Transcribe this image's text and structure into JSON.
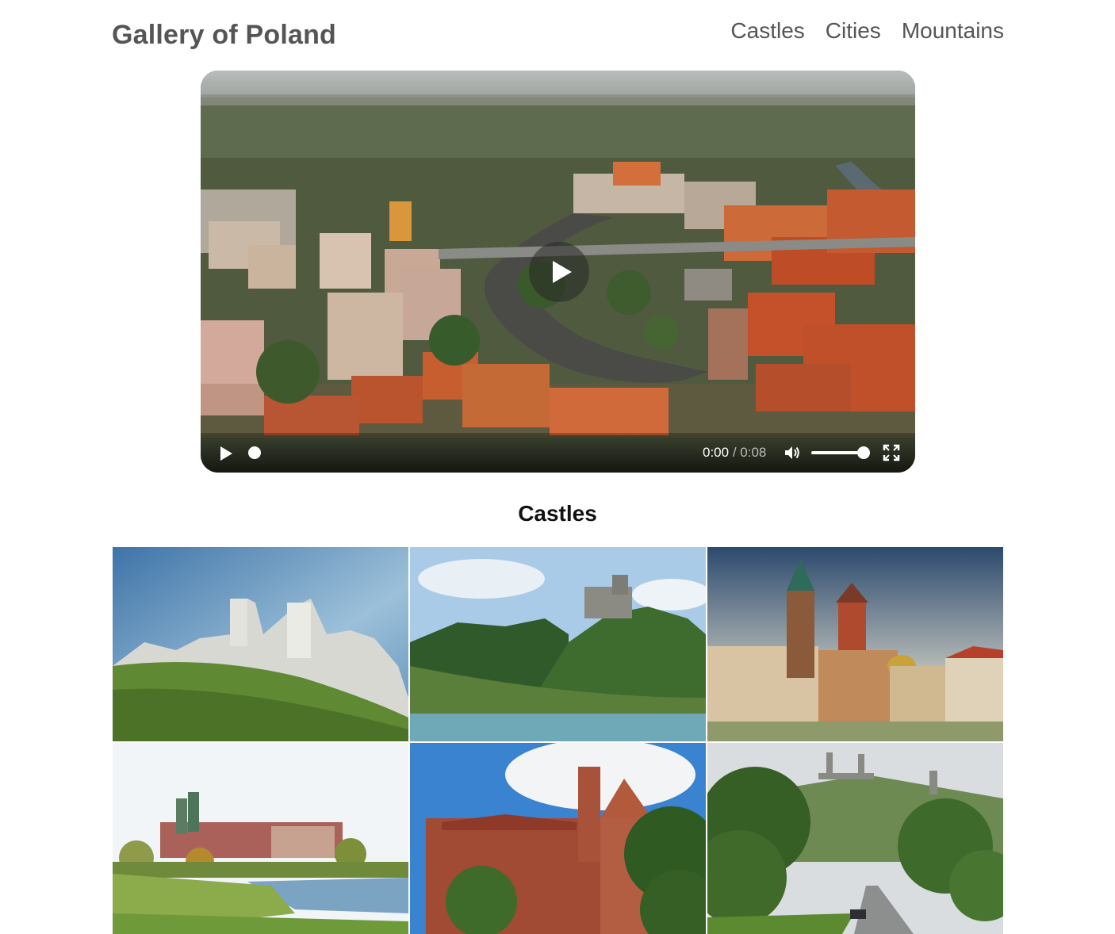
{
  "header": {
    "site_title": "Gallery of Poland",
    "nav": [
      "Castles",
      "Cities",
      "Mountains"
    ]
  },
  "video": {
    "current_time": "0:00",
    "separator": "/",
    "duration": "0:08",
    "progress_fraction": 0.0,
    "volume_fraction": 1.0,
    "icons": {
      "big_play": "play-icon",
      "play": "play-icon",
      "mute": "volume-icon",
      "fullscreen": "fullscreen-icon"
    }
  },
  "section": {
    "title": "Castles"
  },
  "gallery": {
    "tile_count": 6
  },
  "colors": {
    "title_text": "#555555",
    "nav_text": "#555555",
    "heading_text": "#111111"
  }
}
